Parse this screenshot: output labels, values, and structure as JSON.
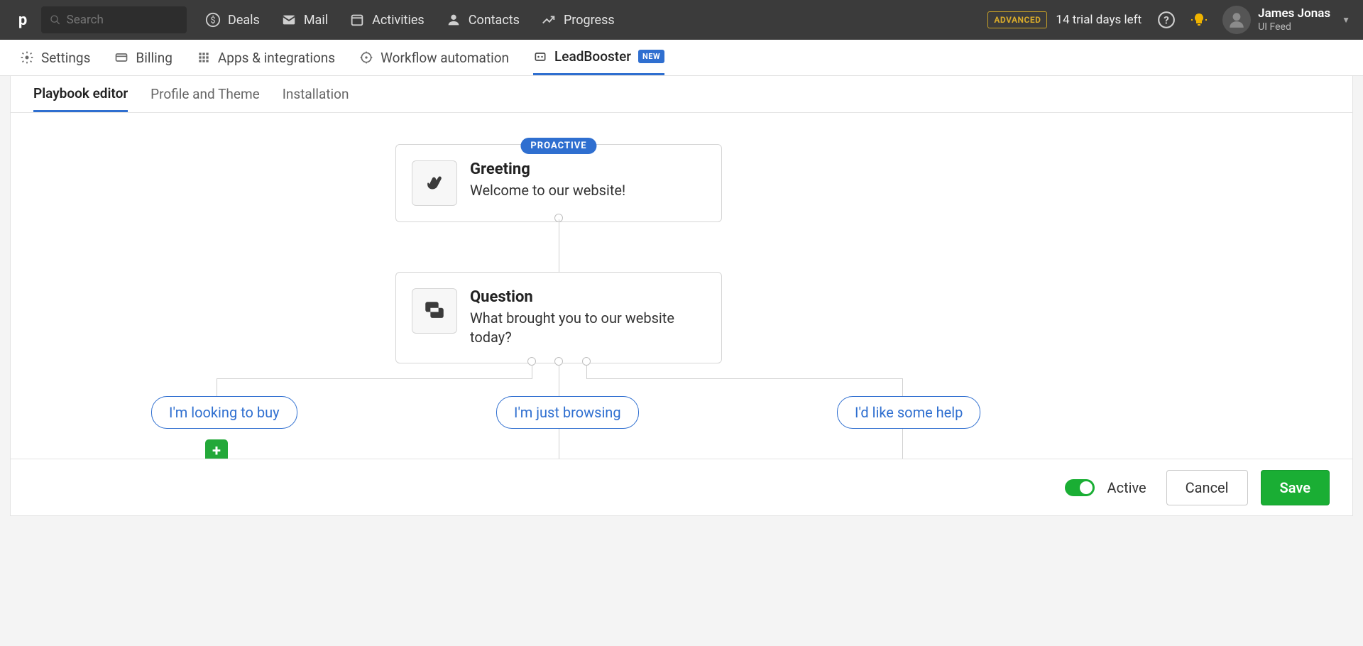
{
  "search": {
    "placeholder": "Search"
  },
  "nav": {
    "deals": "Deals",
    "mail": "Mail",
    "activities": "Activities",
    "contacts": "Contacts",
    "progress": "Progress"
  },
  "top": {
    "advanced": "ADVANCED",
    "trial": "14 trial days left",
    "user_name": "James Jonas",
    "user_sub": "UI Feed"
  },
  "subnav": {
    "settings": "Settings",
    "billing": "Billing",
    "apps": "Apps & integrations",
    "workflow": "Workflow automation",
    "leadbooster": "LeadBooster",
    "new_chip": "NEW"
  },
  "tabs": {
    "playbook": "Playbook editor",
    "profile": "Profile and Theme",
    "install": "Installation"
  },
  "flow": {
    "proactive": "PROACTIVE",
    "greeting_title": "Greeting",
    "greeting_text": "Welcome to our website!",
    "question_title": "Question",
    "question_text": "What brought you to our website today?",
    "ans1": "I'm looking to buy",
    "ans2": "I'm just browsing",
    "ans3": "I'd like some help",
    "add": "+"
  },
  "footer": {
    "active": "Active",
    "cancel": "Cancel",
    "save": "Save"
  }
}
